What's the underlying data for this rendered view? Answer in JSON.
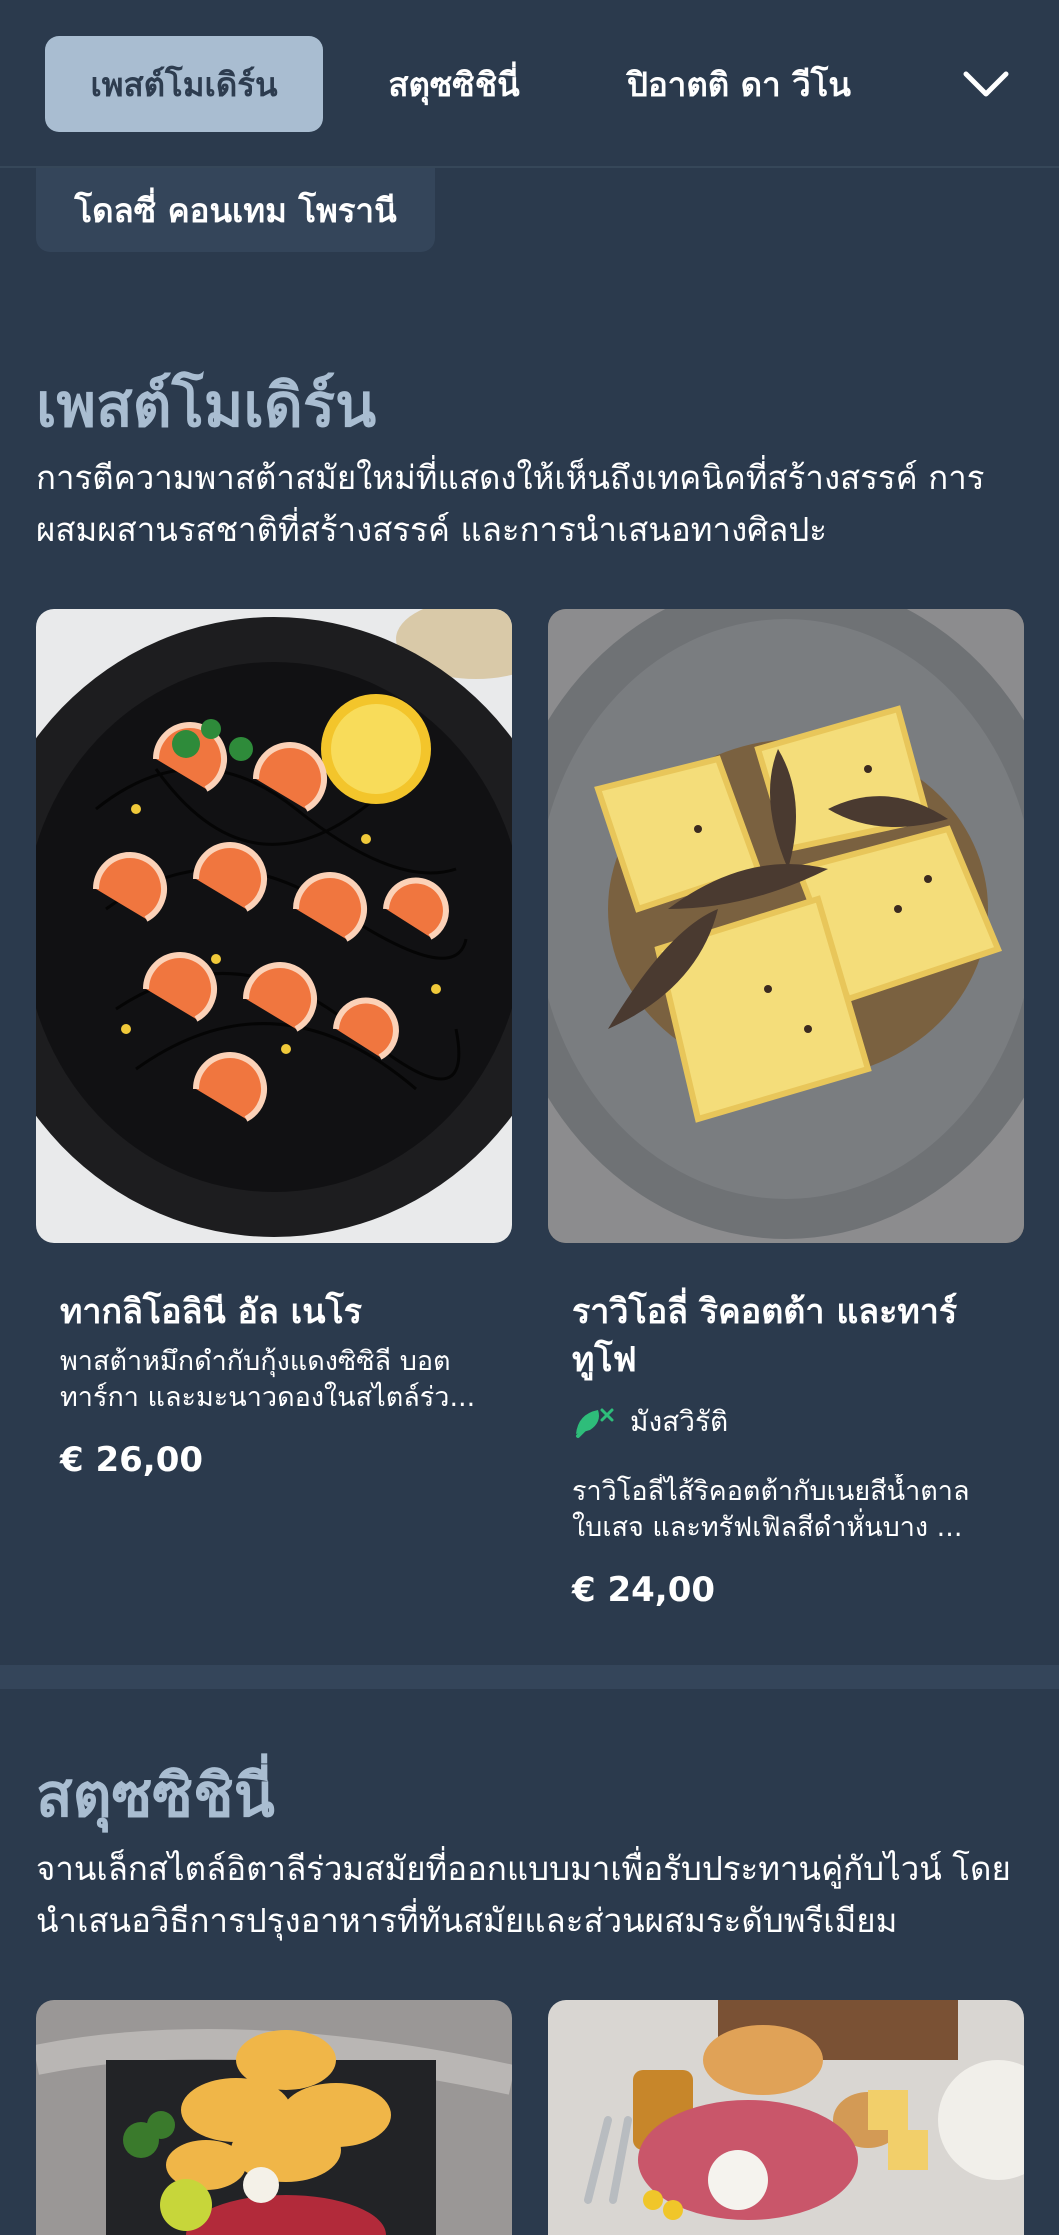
{
  "nav": {
    "tabs": [
      {
        "label": "เพสต์โมเดิร์น",
        "active": true
      },
      {
        "label": "สตุซซิชินี่",
        "active": false
      },
      {
        "label": "ปิอาตติ ดา วีโน",
        "active": false
      }
    ],
    "more_icon": "chevron-down-icon",
    "overflow_tab": "โดลซี่ คอนเทม โพรานี"
  },
  "sections": [
    {
      "title": "เพสต์โมเดิร์น",
      "description": "การตีความพาสต้าสมัยใหม่ที่แสดงให้เห็นถึงเทคนิคที่สร้างสรรค์ การผสมผสานรสชาติที่สร้างสรรค์ และการนำเสนอทางศิลปะ",
      "items": [
        {
          "name": "ทากลิโอลินี อัล เนโร",
          "description": "พาสต้าหมึกดำกับกุ้งแดงซิซิลี บอตทาร์กา และมะนาวดองในสไตล์ร่ว...",
          "price": "€ 26,00"
        },
        {
          "name": "ราวิโอลี่ ริคอตต้า และทาร์ทูโฟ",
          "tag": "มังสวิรัติ",
          "tag_icon": "vegetarian-leaf-icon",
          "description": "ราวิโอลี่ไส้ริคอตต้ากับเนยสีน้ำตาล ใบเสจ และทรัฟเฟิลสีดำหั่นบาง ...",
          "price": "€ 24,00"
        }
      ]
    },
    {
      "title": "สตุซซิชินี่",
      "description": "จานเล็กสไตล์อิตาลีร่วมสมัยที่ออกแบบมาเพื่อรับประทานคู่กับไวน์ โดยนำเสนอวิธีการปรุงอาหารที่ทันสมัยและส่วนผสมระดับพรีเมียม"
    }
  ],
  "colors": {
    "background": "#2b3a4d",
    "active_tab": "#a9bdd1",
    "section_title": "#a9bdd1",
    "veg_icon": "#2ebd7a"
  }
}
